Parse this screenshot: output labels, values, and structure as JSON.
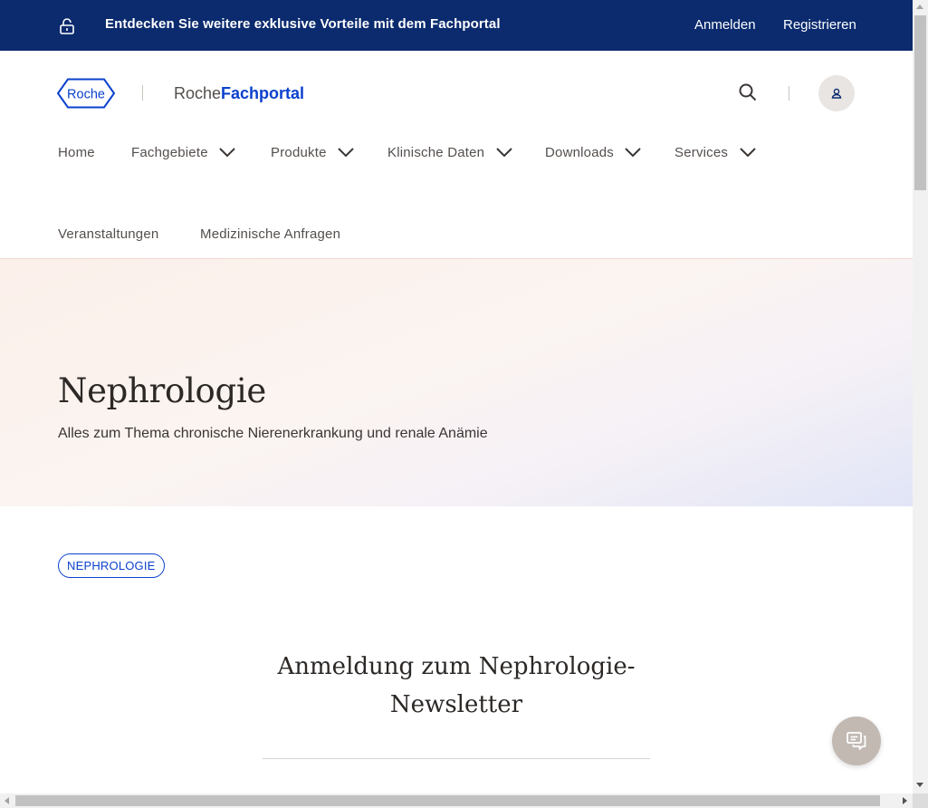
{
  "promo_bar": {
    "message": "Entdecken Sie weitere exklusive Vorteile mit dem Fachportal",
    "login_label": "Anmelden",
    "register_label": "Registrieren",
    "icon": "unlock-icon"
  },
  "header": {
    "logo_text": "Roche",
    "portal_name_light": "Roche",
    "portal_name_bold": "Fachportal",
    "search_icon": "search-icon",
    "user_icon": "user-icon"
  },
  "nav": {
    "items": [
      {
        "label": "Home",
        "has_dropdown": false
      },
      {
        "label": "Fachgebiete",
        "has_dropdown": true
      },
      {
        "label": "Produkte",
        "has_dropdown": true
      },
      {
        "label": "Klinische Daten",
        "has_dropdown": true
      },
      {
        "label": "Downloads",
        "has_dropdown": true
      },
      {
        "label": "Services",
        "has_dropdown": true
      },
      {
        "label": "Veranstaltungen",
        "has_dropdown": false
      },
      {
        "label": "Medizinische Anfragen",
        "has_dropdown": false
      }
    ]
  },
  "hero": {
    "title": "Nephrologie",
    "subtitle": "Alles zum Thema chronische Nierenerkrankung und renale Anämie"
  },
  "tag": {
    "label": "NEPHROLOGIE"
  },
  "newsletter": {
    "title": "Anmeldung zum Nephrologie-Newsletter"
  },
  "chat": {
    "icon": "chat-icon"
  },
  "colors": {
    "brand_dark": "#0b2b6e",
    "brand_blue": "#0b41cd",
    "text": "#3a3634",
    "chat_bg": "#c2b9b3"
  }
}
